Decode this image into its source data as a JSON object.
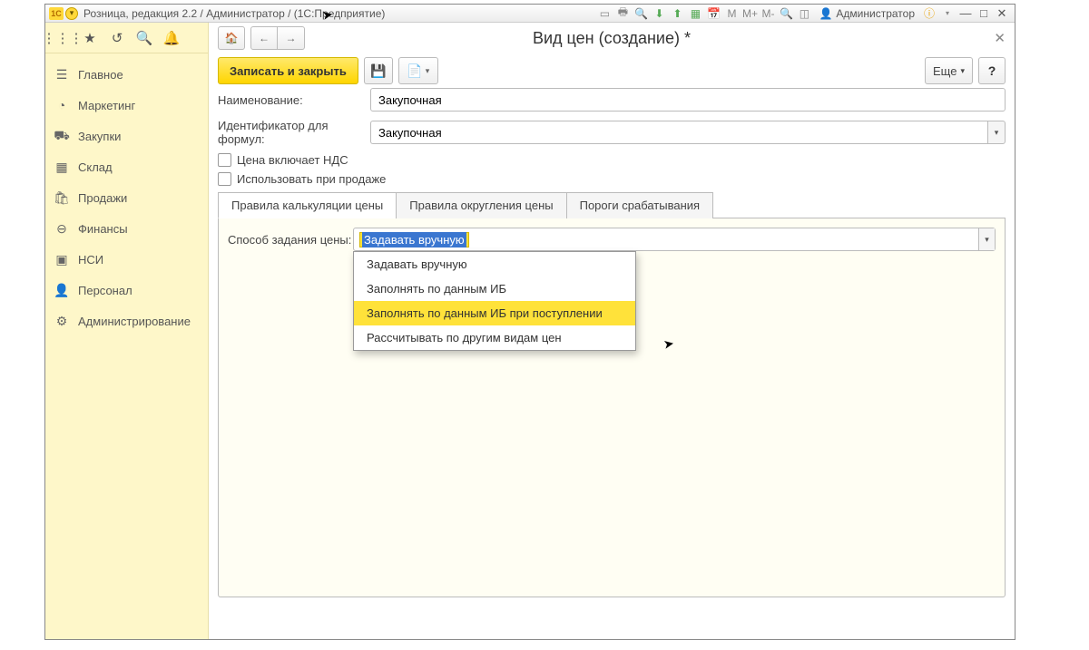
{
  "titlebar": {
    "app_logo_text": "1C",
    "title": "Розница, редакция 2.2 / Администратор / (1С:Предприятие)",
    "user_label": "Администратор",
    "m_label": "M",
    "m_plus": "M+",
    "m_minus": "M-"
  },
  "sidebar": {
    "items": [
      {
        "icon": "☰",
        "label": "Главное"
      },
      {
        "icon": "◔",
        "label": "Маркетинг"
      },
      {
        "icon": "⛟",
        "label": "Закупки"
      },
      {
        "icon": "▦",
        "label": "Склад"
      },
      {
        "icon": "🛍",
        "label": "Продажи"
      },
      {
        "icon": "⊖",
        "label": "Финансы"
      },
      {
        "icon": "▣",
        "label": "НСИ"
      },
      {
        "icon": "👤",
        "label": "Персонал"
      },
      {
        "icon": "⚙",
        "label": "Администрирование"
      }
    ]
  },
  "page": {
    "title": "Вид цен (создание) *"
  },
  "toolbar": {
    "save_close": "Записать и закрыть",
    "more": "Еще",
    "help": "?"
  },
  "form": {
    "name_label": "Наименование:",
    "name_value": "Закупочная",
    "id_label": "Идентификатор для формул:",
    "id_value": "Закупочная",
    "vat_label": "Цена включает НДС",
    "use_on_sale_label": "Использовать при продаже",
    "tabs": [
      "Правила калькуляции цены",
      "Правила округления цены",
      "Пороги срабатывания"
    ],
    "method_label": "Способ задания цены:",
    "method_value": "Задавать вручную",
    "method_options": [
      "Задавать вручную",
      "Заполнять по данным ИБ",
      "Заполнять по данным ИБ при поступлении",
      "Рассчитывать по другим видам цен"
    ]
  }
}
